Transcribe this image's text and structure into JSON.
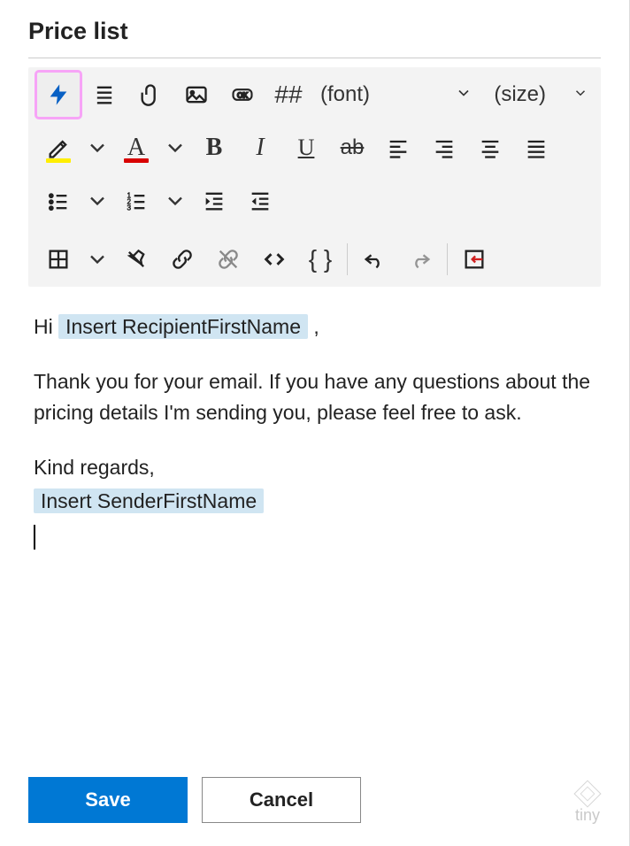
{
  "header": {
    "title": "Price list"
  },
  "toolbar": {
    "font_label": "(font)",
    "size_label": "(size)",
    "hash_label": "##",
    "highlight_color": "#ffee00",
    "text_color": "#d80000"
  },
  "editor": {
    "greeting_prefix": "Hi ",
    "greeting_suffix": " ,",
    "placeholder_recipient": "Insert RecipientFirstName",
    "body": "Thank you for your email. If you have any questions about the pricing details I'm sending you, please feel free to ask.",
    "signoff": "Kind regards,",
    "placeholder_sender": "Insert SenderFirstName"
  },
  "actions": {
    "save_label": "Save",
    "cancel_label": "Cancel"
  },
  "branding": {
    "logo_text": "tiny"
  }
}
